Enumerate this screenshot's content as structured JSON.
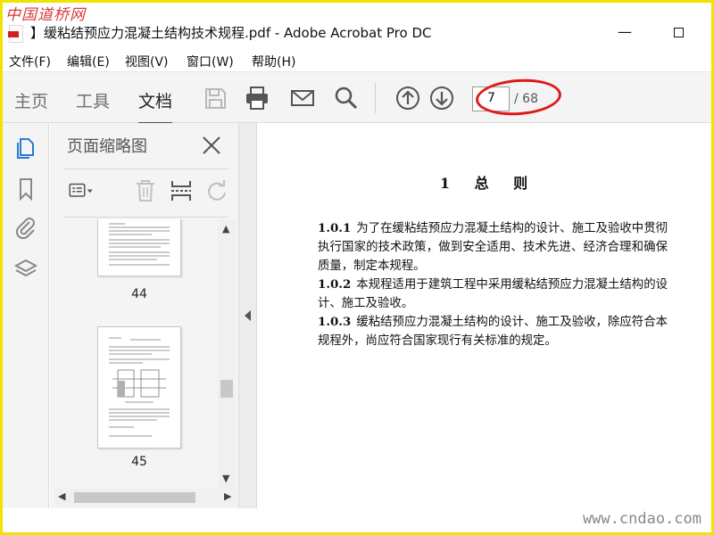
{
  "watermarks": {
    "top": "中国道桥网",
    "bottom": "www.cndao.com"
  },
  "window": {
    "title": "】缓粘结预应力混凝土结构技术规程.pdf - Adobe Acrobat Pro DC",
    "minimize_glyph": "—"
  },
  "menu": [
    "文件(F)",
    "编辑(E)",
    "视图(V)",
    "窗口(W)",
    "帮助(H)"
  ],
  "toolbar": {
    "tabs": [
      "主页",
      "工具",
      "文档"
    ],
    "active_tab": "文档",
    "icons": [
      "save-icon",
      "print-icon",
      "email-icon",
      "search-icon",
      "page-up-icon",
      "page-down-icon"
    ],
    "current_page": "7",
    "total_pages": "/ 68"
  },
  "sidebar": {
    "icons": [
      "pages-icon",
      "bookmark-icon",
      "attachment-icon",
      "layers-icon"
    ]
  },
  "thumbnail_panel": {
    "title": "页面缩略图",
    "tools": [
      "thumbnail-options-icon",
      "delete-page-icon",
      "insert-page-icon",
      "rotate-icon"
    ],
    "thumbnails": [
      {
        "number": "44"
      },
      {
        "number": "45"
      }
    ]
  },
  "document": {
    "title": "1 总 则",
    "clauses": [
      {
        "number": "1.0.1",
        "text": "为了在缓粘结预应力混凝土结构的设计、施工及验收中贯彻执行国家的技术政策，做到安全适用、技术先进、经济合理和确保质量，制定本规程。"
      },
      {
        "number": "1.0.2",
        "text": "本规程适用于建筑工程中采用缓粘结预应力混凝土结构的设计、施工及验收。"
      },
      {
        "number": "1.0.3",
        "text": "缓粘结预应力混凝土结构的设计、施工及验收，除应符合本规程外，尚应符合国家现行有关标准的规定。"
      }
    ]
  },
  "colors": {
    "annotation_ellipse": "#e01818",
    "frame": "#f2e200",
    "accent_icon": "#2b7bd6"
  }
}
